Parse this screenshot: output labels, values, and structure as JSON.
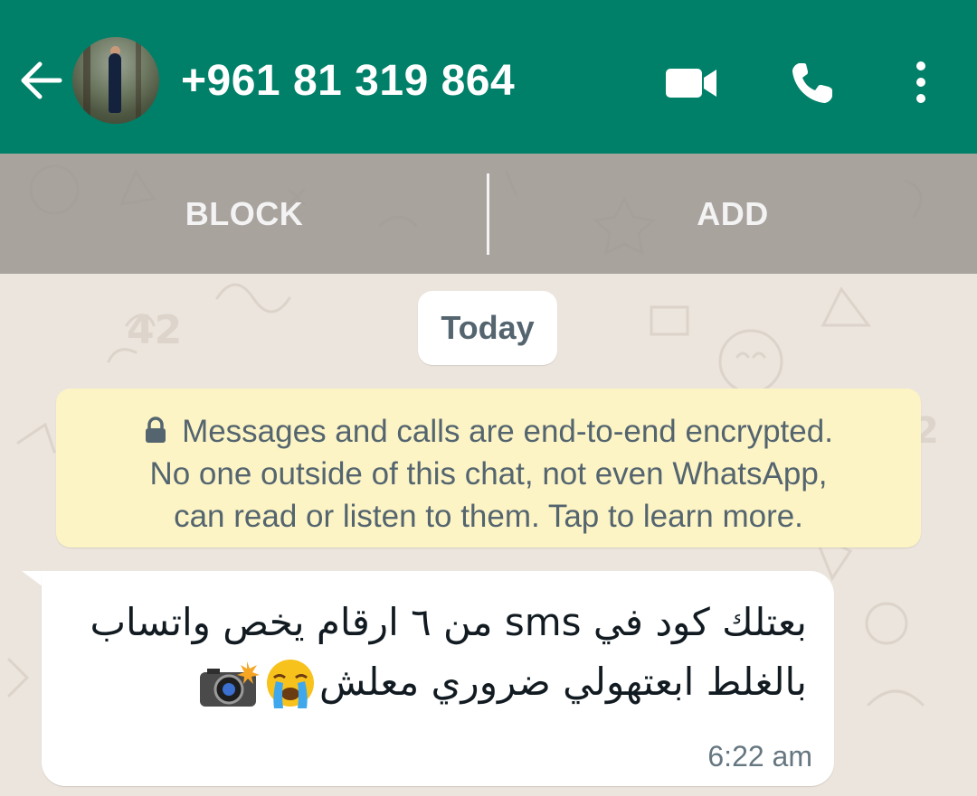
{
  "header": {
    "back_icon": "arrow-left-icon",
    "title": "+961 81 319 864",
    "actions": [
      "video-call-icon",
      "phone-call-icon",
      "more-vertical-icon"
    ],
    "background": "#008069"
  },
  "actionbar": {
    "block_label": "BLOCK",
    "add_label": "ADD"
  },
  "chat": {
    "date_label": "Today",
    "encryption_notice": {
      "line1": "Messages and calls are end-to-end encrypted.",
      "line2": "No one outside of this chat, not even WhatsApp,",
      "line3": "can read or listen to them. Tap to learn more."
    },
    "messages": [
      {
        "direction": "incoming",
        "line1": "بعتلك كود في sms من ٦ ارقام يخص واتساب",
        "line2": "بالغلط ابعتهولي ضروري معلش",
        "emojis": [
          "😭",
          "📸"
        ],
        "time": "6:22 am"
      }
    ]
  },
  "colors": {
    "wallpaper": "#ece5dd",
    "bubble_incoming": "#ffffff",
    "notice_bg": "#fdf4c5",
    "secondary_text": "#54656f"
  }
}
